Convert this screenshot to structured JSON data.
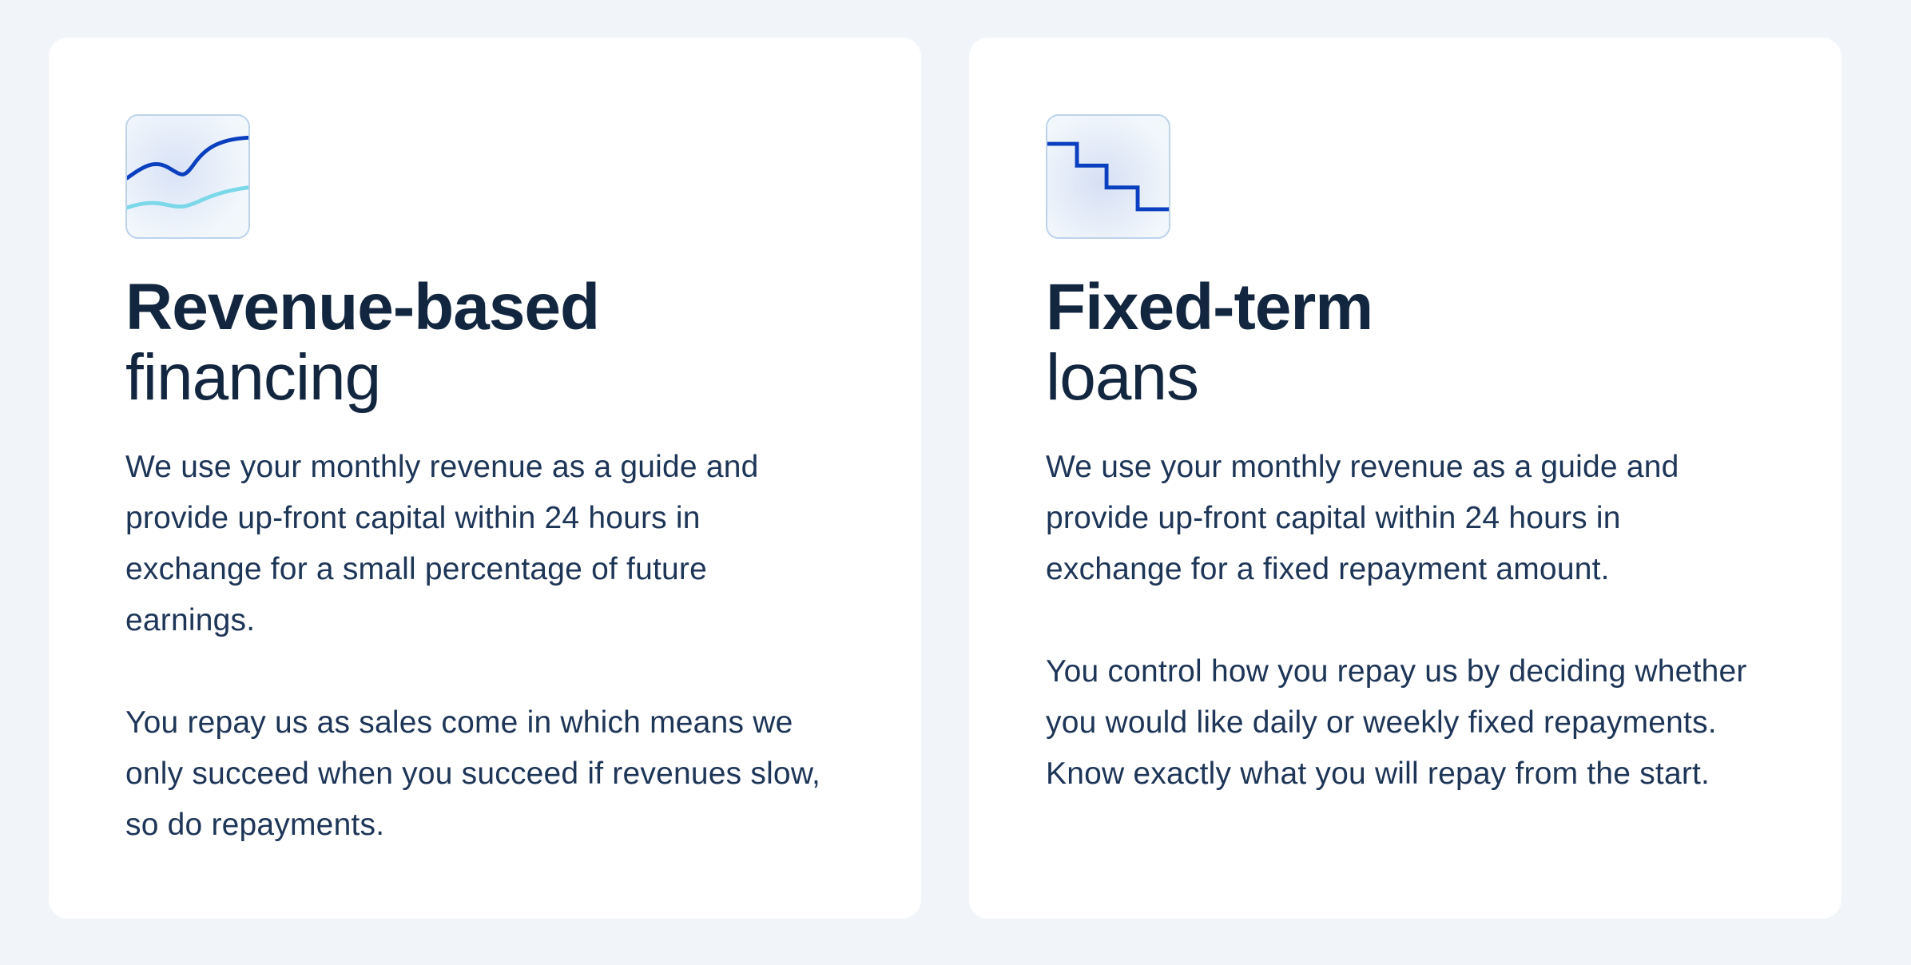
{
  "colors": {
    "page_background": "#f1f5f9",
    "card_background": "#ffffff",
    "text_primary": "#13263f",
    "accent_dark_blue": "#0a3fbf",
    "accent_cyan": "#7ad8e8"
  },
  "cards": [
    {
      "icon": "wave-chart-icon",
      "title_bold": "Revenue-based",
      "title_light": "financing",
      "paragraphs": [
        "We use your monthly revenue as a guide and provide up-front capital within 24 hours in exchange for a small percentage of future earnings.",
        "You repay us as sales come in which means we only succeed when you succeed if revenues slow, so do repayments."
      ]
    },
    {
      "icon": "step-chart-icon",
      "title_bold": "Fixed-term",
      "title_light": "loans",
      "paragraphs": [
        "We use your monthly revenue as a guide and provide up-front capital within 24 hours in exchange for a fixed repayment amount.",
        "You control how you repay us by deciding whether you would like daily or weekly fixed repayments. Know exactly what you will repay from the start."
      ]
    }
  ]
}
